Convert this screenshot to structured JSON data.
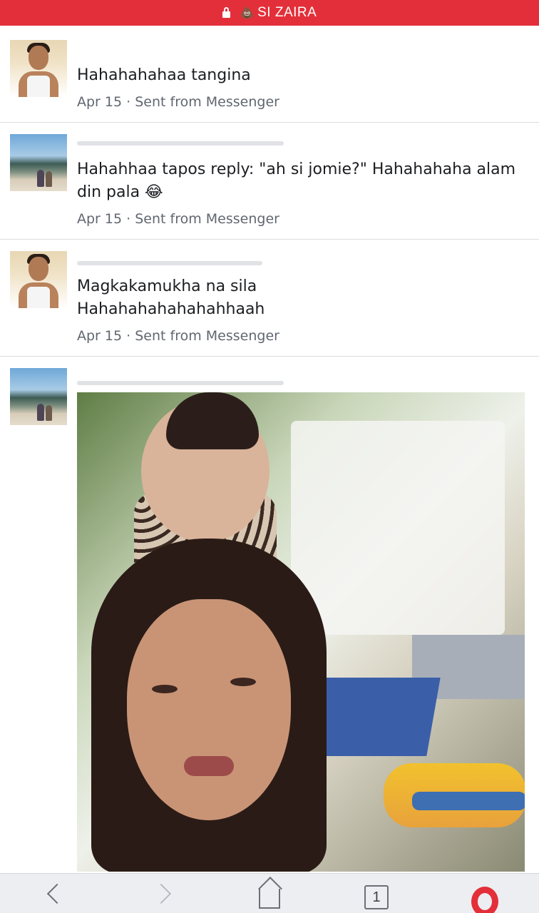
{
  "topbar": {
    "title": "SI ZAIRA",
    "poop": "💩"
  },
  "comments": [
    {
      "text": "Hahahahahaa tangina",
      "date": "Apr 15",
      "separator": "·",
      "source": "Sent from Messenger"
    },
    {
      "text": "Hahahhaa tapos reply: \"ah si jomie?\" Hahahahaha alam din pala 😂",
      "date": "Apr 15",
      "separator": "·",
      "source": "Sent from Messenger"
    },
    {
      "text": "Magkakamukha na sila Hahahahahahahahhaah",
      "date": "Apr 15",
      "separator": "·",
      "source": "Sent from Messenger"
    }
  ],
  "bottombar": {
    "tab_count": "1"
  },
  "colors": {
    "accent": "#e32f3a",
    "meta": "#606770"
  }
}
